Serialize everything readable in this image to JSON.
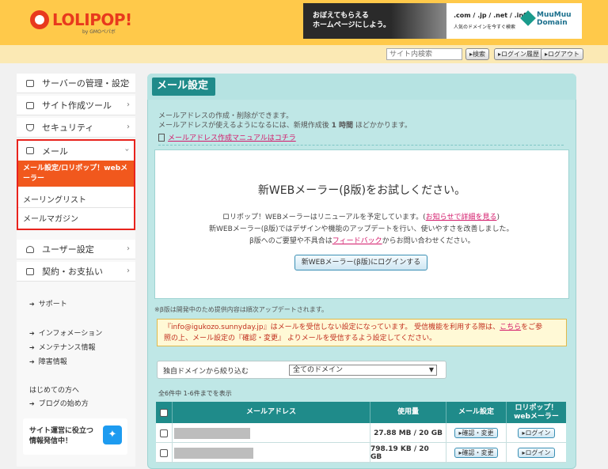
{
  "brand": {
    "name": "LOLIPOP!",
    "sub": "by GMOペパボ"
  },
  "banner": {
    "left_line1": "おぼえてもらえる",
    "left_line2": "ホームページにしよう。",
    "domains": ".com / .jp / .net / .info",
    "domains_caption": "人気のドメインを今すぐ検索",
    "mm_line1": "MuuMuu",
    "mm_line2": "Domain"
  },
  "topbar": {
    "search_placeholder": "サイト内検索",
    "search_button": "検索",
    "history_button": "ログイン履歴",
    "logout_button": "ログアウト"
  },
  "sidebar": {
    "items": [
      {
        "label": "サーバーの管理・設定",
        "icon": "server-icon"
      },
      {
        "label": "サイト作成ツール",
        "icon": "site-tool-icon"
      },
      {
        "label": "セキュリティ",
        "icon": "shield-icon"
      },
      {
        "label": "メール",
        "icon": "mail-icon"
      }
    ],
    "mail_sub": {
      "active": "メール設定/ロリポップ！webメーラー",
      "items": [
        "メーリングリスト",
        "メールマガジン"
      ]
    },
    "items2": [
      {
        "label": "ユーザー設定",
        "icon": "user-icon"
      },
      {
        "label": "契約・お支払い",
        "icon": "card-icon"
      }
    ],
    "links": [
      "サポート",
      "インフォメーション",
      "メンテナンス情報",
      "障害情報"
    ],
    "beginner_text": "はじめての方へ",
    "beginner_link": "ブログの始め方",
    "twitter_line1": "サイト運営に役立つ",
    "twitter_line2": "情報発信中！"
  },
  "main": {
    "title": "メール設定",
    "intro1": "メールアドレスの作成・削除ができます。",
    "intro2_a": "メールアドレスが使えるようになるには、新規作成後",
    "intro2_b": "1 時間",
    "intro2_c": "ほどかかります。",
    "manual_link": "メールアドレス作成マニュアルはコチラ",
    "webmail": {
      "title": "新WEBメーラー(β版)をお試しください。",
      "line1_a": "ロリポップ！WEBメーラーはリニューアルを予定しています。(",
      "line1_link": "お知らせで詳細を見る",
      "line1_b": ")",
      "line2": "新WEBメーラー(β版)ではデザインや機能のアップデートを行い、使いやすさを改善しました。",
      "line3_a": "β版へのご要望や不具合は",
      "line3_link": "フィードバック",
      "line3_b": "からお問い合わせください。",
      "button": "新WEBメーラー(β版)にログインする"
    },
    "note": "※β版は開発中のため提供内容は順次アップデートされます。",
    "warning_a": "『info@igukozo.sunnyday.jp』はメールを受信しない設定になっています。 受信機能を利用する際は、",
    "warning_link": "こちら",
    "warning_b": "をご参",
    "warning_line2": "照の上、メール設定の『確認・変更』 よりメールを受信するよう設定してください。",
    "filter_label": "独自ドメインから絞り込む",
    "filter_value": "全てのドメイン",
    "count": "全6件中 1-6件までを表示",
    "table": {
      "headers": [
        "メールアドレス",
        "使用量",
        "メール設定",
        "ロリポップ！webメーラー"
      ],
      "rows": [
        {
          "usage": "27.88 MB / 20 GB",
          "settings": "確認・変更",
          "login": "ログイン"
        },
        {
          "usage": "798.19 KB / 20 GB",
          "settings": "確認・変更",
          "login": "ログイン"
        }
      ]
    }
  }
}
